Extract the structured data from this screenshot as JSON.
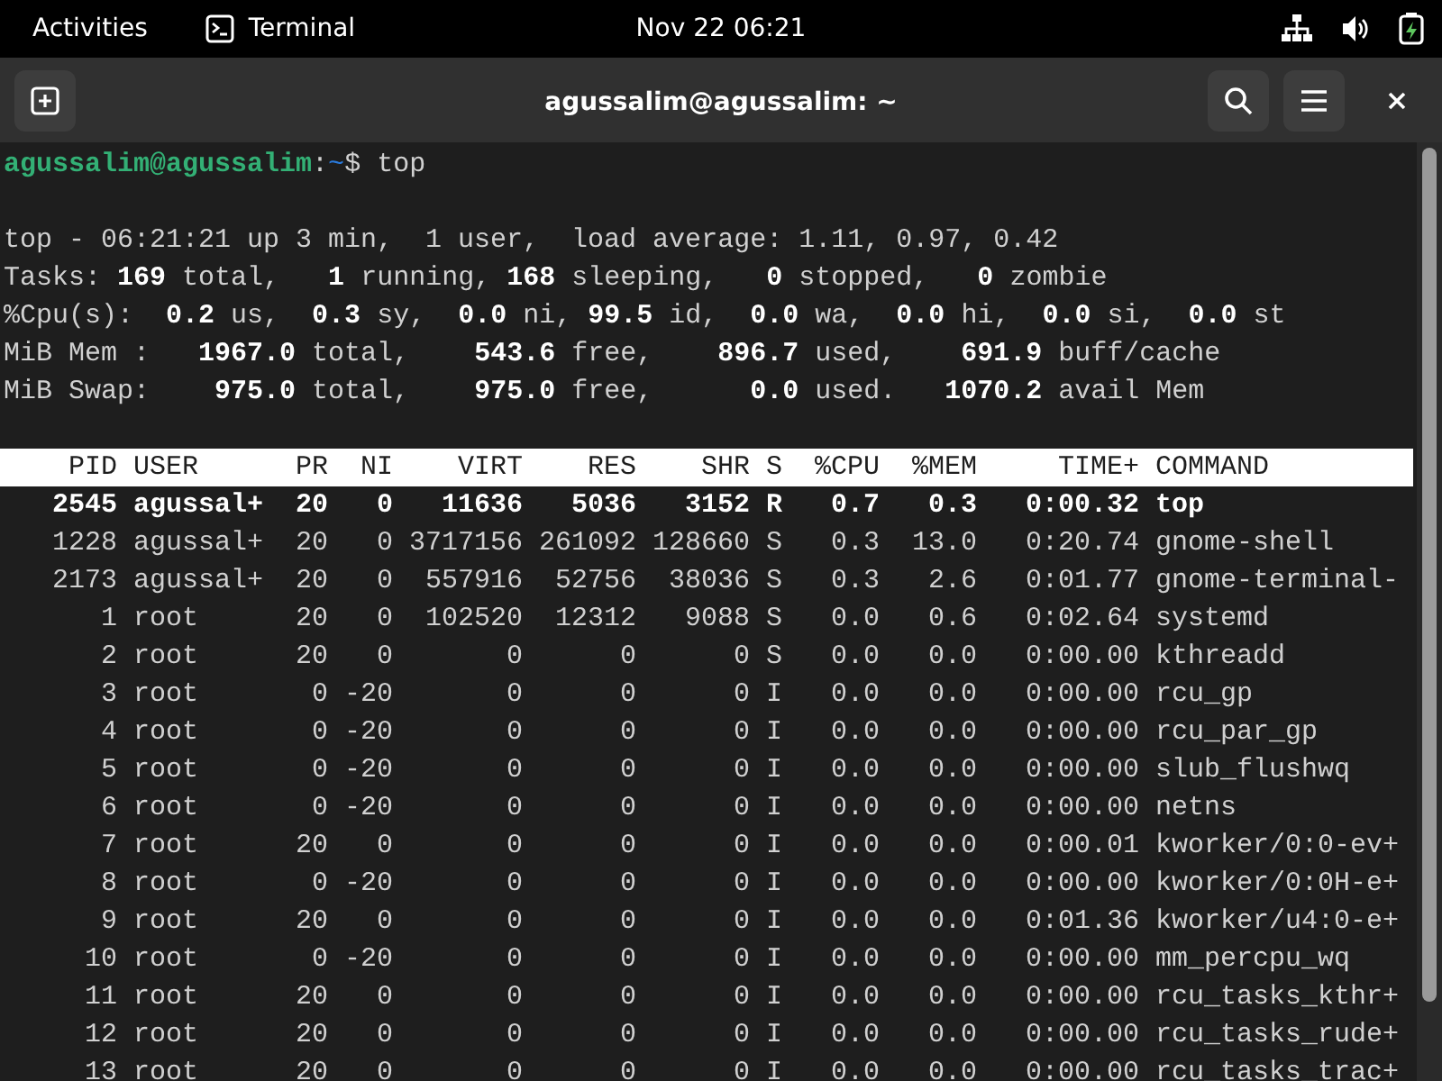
{
  "top_bar": {
    "activities": "Activities",
    "app": "Terminal",
    "clock": "Nov 22  06:21"
  },
  "window": {
    "title": "agussalim@agussalim: ~"
  },
  "prompt": {
    "user_host": "agussalim@agussalim",
    "separator": ":",
    "path": "~",
    "command": "$ top"
  },
  "summary": [
    "top - 06:21:21 up 3 min,  1 user,  load average: 1.11, 0.97, 0.42",
    "Tasks: **169** total,   **1** running, **168** sleeping,   **0** stopped,   **0** zombie",
    "%Cpu(s):  **0.2** us,  **0.3** sy,  **0.0** ni, **99.5** id,  **0.0** wa,  **0.0** hi,  **0.0** si,  **0.0** st",
    "MiB Mem :   **1967.0** total,    **543.6** free,    **896.7** used,    **691.9** buff/cache",
    "MiB Swap:    **975.0** total,    **975.0** free,      **0.0** used.   **1070.2** avail Mem"
  ],
  "table": {
    "columns": [
      "PID",
      "USER",
      "PR",
      "NI",
      "VIRT",
      "RES",
      "SHR",
      "S",
      "%CPU",
      "%MEM",
      "TIME+",
      "COMMAND"
    ],
    "rows": [
      {
        "highlighted": true,
        "cells": [
          "2545",
          "agussal+",
          "20",
          "0",
          "11636",
          "5036",
          "3152",
          "R",
          "0.7",
          "0.3",
          "0:00.32",
          "top"
        ]
      },
      {
        "highlighted": false,
        "cells": [
          "1228",
          "agussal+",
          "20",
          "0",
          "3717156",
          "261092",
          "128660",
          "S",
          "0.3",
          "13.0",
          "0:20.74",
          "gnome-shell"
        ]
      },
      {
        "highlighted": false,
        "cells": [
          "2173",
          "agussal+",
          "20",
          "0",
          "557916",
          "52756",
          "38036",
          "S",
          "0.3",
          "2.6",
          "0:01.77",
          "gnome-terminal-"
        ]
      },
      {
        "highlighted": false,
        "cells": [
          "1",
          "root",
          "20",
          "0",
          "102520",
          "12312",
          "9088",
          "S",
          "0.0",
          "0.6",
          "0:02.64",
          "systemd"
        ]
      },
      {
        "highlighted": false,
        "cells": [
          "2",
          "root",
          "20",
          "0",
          "0",
          "0",
          "0",
          "S",
          "0.0",
          "0.0",
          "0:00.00",
          "kthreadd"
        ]
      },
      {
        "highlighted": false,
        "cells": [
          "3",
          "root",
          "0",
          "-20",
          "0",
          "0",
          "0",
          "I",
          "0.0",
          "0.0",
          "0:00.00",
          "rcu_gp"
        ]
      },
      {
        "highlighted": false,
        "cells": [
          "4",
          "root",
          "0",
          "-20",
          "0",
          "0",
          "0",
          "I",
          "0.0",
          "0.0",
          "0:00.00",
          "rcu_par_gp"
        ]
      },
      {
        "highlighted": false,
        "cells": [
          "5",
          "root",
          "0",
          "-20",
          "0",
          "0",
          "0",
          "I",
          "0.0",
          "0.0",
          "0:00.00",
          "slub_flushwq"
        ]
      },
      {
        "highlighted": false,
        "cells": [
          "6",
          "root",
          "0",
          "-20",
          "0",
          "0",
          "0",
          "I",
          "0.0",
          "0.0",
          "0:00.00",
          "netns"
        ]
      },
      {
        "highlighted": false,
        "cells": [
          "7",
          "root",
          "20",
          "0",
          "0",
          "0",
          "0",
          "I",
          "0.0",
          "0.0",
          "0:00.01",
          "kworker/0:0-ev+"
        ]
      },
      {
        "highlighted": false,
        "cells": [
          "8",
          "root",
          "0",
          "-20",
          "0",
          "0",
          "0",
          "I",
          "0.0",
          "0.0",
          "0:00.00",
          "kworker/0:0H-e+"
        ]
      },
      {
        "highlighted": false,
        "cells": [
          "9",
          "root",
          "20",
          "0",
          "0",
          "0",
          "0",
          "I",
          "0.0",
          "0.0",
          "0:01.36",
          "kworker/u4:0-e+"
        ]
      },
      {
        "highlighted": false,
        "cells": [
          "10",
          "root",
          "0",
          "-20",
          "0",
          "0",
          "0",
          "I",
          "0.0",
          "0.0",
          "0:00.00",
          "mm_percpu_wq"
        ]
      },
      {
        "highlighted": false,
        "cells": [
          "11",
          "root",
          "20",
          "0",
          "0",
          "0",
          "0",
          "I",
          "0.0",
          "0.0",
          "0:00.00",
          "rcu_tasks_kthr+"
        ]
      },
      {
        "highlighted": false,
        "cells": [
          "12",
          "root",
          "20",
          "0",
          "0",
          "0",
          "0",
          "I",
          "0.0",
          "0.0",
          "0:00.00",
          "rcu_tasks_rude+"
        ]
      },
      {
        "highlighted": false,
        "cells": [
          "13",
          "root",
          "20",
          "0",
          "0",
          "0",
          "0",
          "I",
          "0.0",
          "0.0",
          "0:00.00",
          "rcu_tasks_trac+"
        ]
      }
    ]
  }
}
